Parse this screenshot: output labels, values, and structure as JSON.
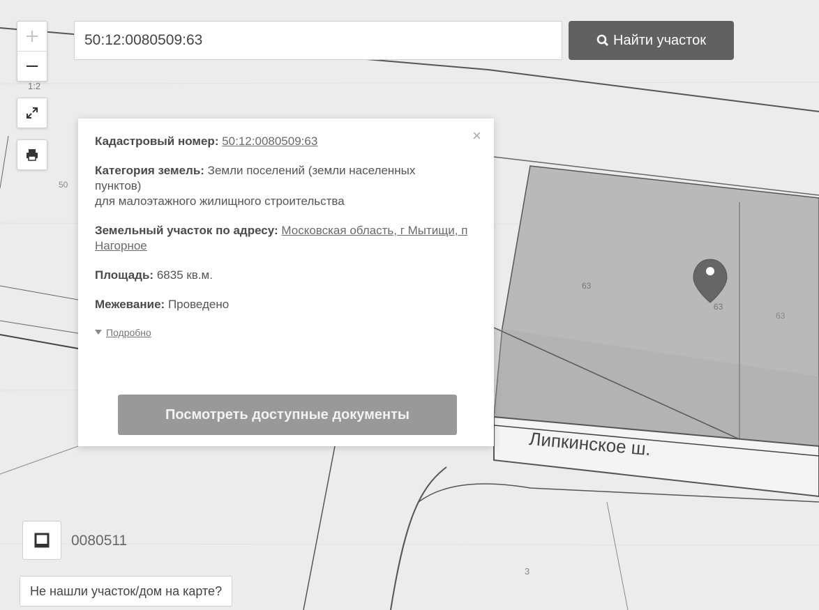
{
  "search": {
    "value": "50:12:0080509:63",
    "button_label": "Найти участок"
  },
  "map": {
    "zoom_in": "+",
    "zoom_out": "−",
    "scale": "1:2",
    "parcel_labels": [
      "50",
      "63",
      "63",
      "63",
      "3"
    ],
    "road_label": "Липкинское ш."
  },
  "popup": {
    "close": "×",
    "cadastral_label": "Кадастровый номер:",
    "cadastral_value": "50:12:0080509:63",
    "category_label": "Категория земель:",
    "category_value": "Земли поселений (земли населенных пунктов)",
    "category_use": "для малоэтажного жилищного строительства",
    "address_label": "Земельный участок по адресу:",
    "address_value": "Московская область, г Мытищи, п Нагорное",
    "area_label": "Площадь:",
    "area_value": "6835 кв.м.",
    "survey_label": "Межевание:",
    "survey_value": "Проведено",
    "details_link": "Подробно",
    "docs_button": "Посмотреть доступные документы"
  },
  "bottom": {
    "quarter_label": "0080511",
    "not_found_button": "Не нашли участок/дом на карте?"
  },
  "colors": {
    "search_button": "#616161",
    "docs_button": "#999999",
    "parcel_fill": "#b9b9b9",
    "marker": "#666666"
  }
}
